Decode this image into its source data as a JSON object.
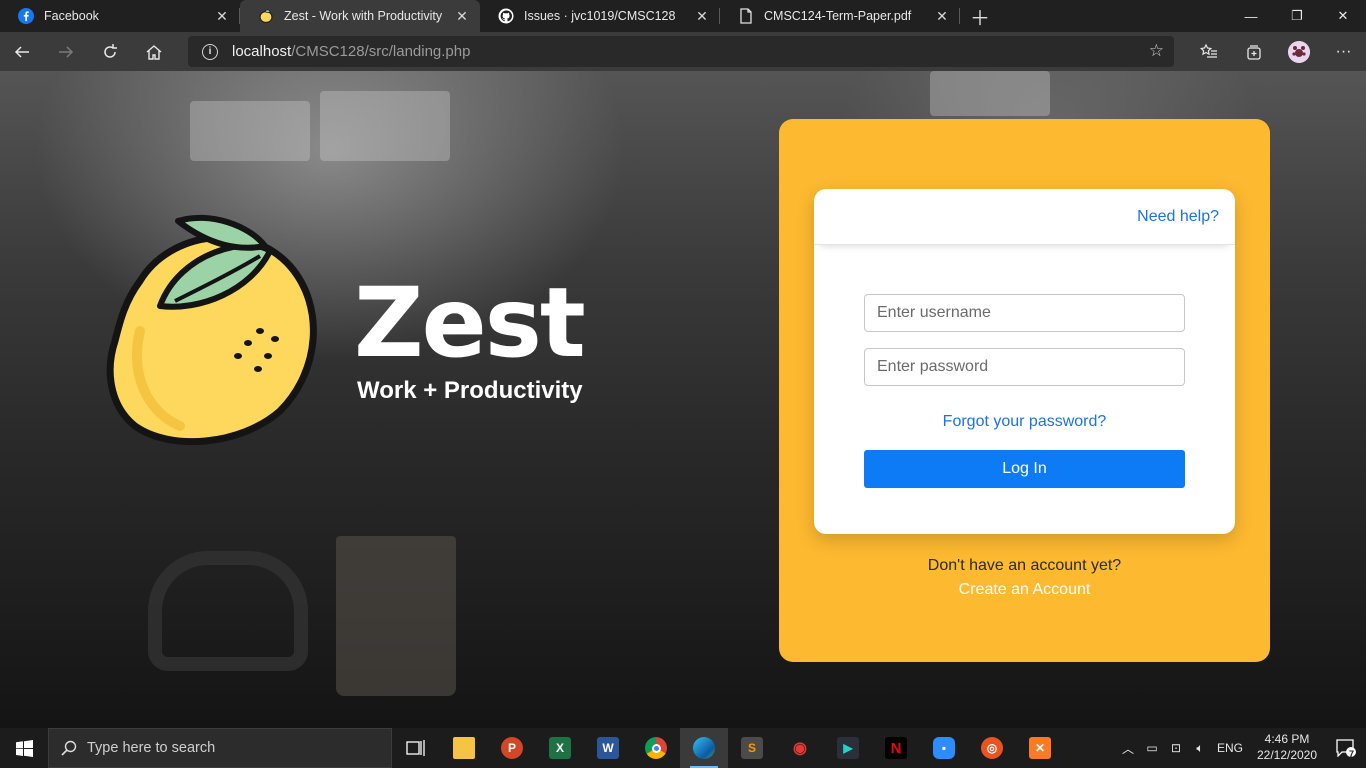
{
  "browser": {
    "tabs": [
      {
        "title": "Facebook",
        "icon": "facebook-icon",
        "active": false
      },
      {
        "title": "Zest - Work with Productivity",
        "icon": "lemon-icon",
        "active": true
      },
      {
        "title": "Issues · jvc1019/CMSC128",
        "icon": "github-icon",
        "active": false
      },
      {
        "title": "CMSC124-Term-Paper.pdf",
        "icon": "document-icon",
        "active": false
      }
    ],
    "address": {
      "host": "localhost",
      "path": "/CMSC128/src/landing.php"
    }
  },
  "landing": {
    "brand": "Zest",
    "tagline": "Work + Productivity",
    "login_card": {
      "help_link": "Need help?",
      "username_placeholder": "Enter username",
      "password_placeholder": "Enter password",
      "forgot_link": "Forgot your password?",
      "login_button": "Log In"
    },
    "no_account_text": "Don't have an account yet?",
    "create_account_link": "Create an Account"
  },
  "taskbar": {
    "search_placeholder": "Type here to search",
    "apps": [
      "task-view",
      "file-explorer",
      "powerpoint",
      "excel",
      "word",
      "chrome",
      "edge",
      "sublime-text",
      "garena",
      "app",
      "netflix",
      "zoom",
      "ubuntu",
      "xampp"
    ],
    "language": "ENG",
    "time": "4:46 PM",
    "date": "22/12/2020",
    "notification_count": "7"
  },
  "colors": {
    "panel": "#fdb930",
    "link": "#1a73e8",
    "button": "#0d7bf5"
  }
}
